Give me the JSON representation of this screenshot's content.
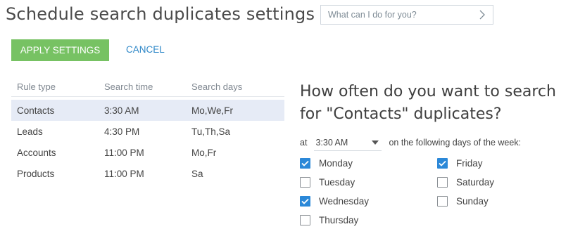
{
  "page": {
    "title": "Schedule search duplicates settings"
  },
  "search": {
    "placeholder": "What can I do for you?"
  },
  "toolbar": {
    "apply_label": "APPLY SETTINGS",
    "cancel_label": "CANCEL"
  },
  "rules": {
    "headers": {
      "type": "Rule type",
      "time": "Search time",
      "days": "Search days"
    },
    "rows": [
      {
        "type": "Contacts",
        "time": "3:30 AM",
        "days": "Mo,We,Fr",
        "selected": true
      },
      {
        "type": "Leads",
        "time": "4:30 PM",
        "days": "Tu,Th,Sa",
        "selected": false
      },
      {
        "type": "Accounts",
        "time": "11:00 PM",
        "days": "Mo,Fr",
        "selected": false
      },
      {
        "type": "Products",
        "time": "11:00 PM",
        "days": "Sa",
        "selected": false
      }
    ]
  },
  "schedule": {
    "question_line1": "How often do you want to search",
    "question_line2": "for \"Contacts\" duplicates?",
    "at_label": "at",
    "time_value": "3:30 AM",
    "days_suffix": "on the following days of the week:",
    "days": [
      {
        "label": "Monday",
        "checked": true
      },
      {
        "label": "Tuesday",
        "checked": false
      },
      {
        "label": "Wednesday",
        "checked": true
      },
      {
        "label": "Thursday",
        "checked": false
      },
      {
        "label": "Friday",
        "checked": true
      },
      {
        "label": "Saturday",
        "checked": false
      },
      {
        "label": "Sunday",
        "checked": false
      }
    ]
  },
  "colors": {
    "accent_green": "#77c263",
    "link_blue": "#2f88c8",
    "checkbox_blue": "#2b88d8",
    "selected_row": "#e6ebf6"
  },
  "icons": {
    "search_chevron": "chevron-right-icon",
    "time_dropdown": "chevron-down-icon",
    "checkbox_mark": "check-icon"
  }
}
